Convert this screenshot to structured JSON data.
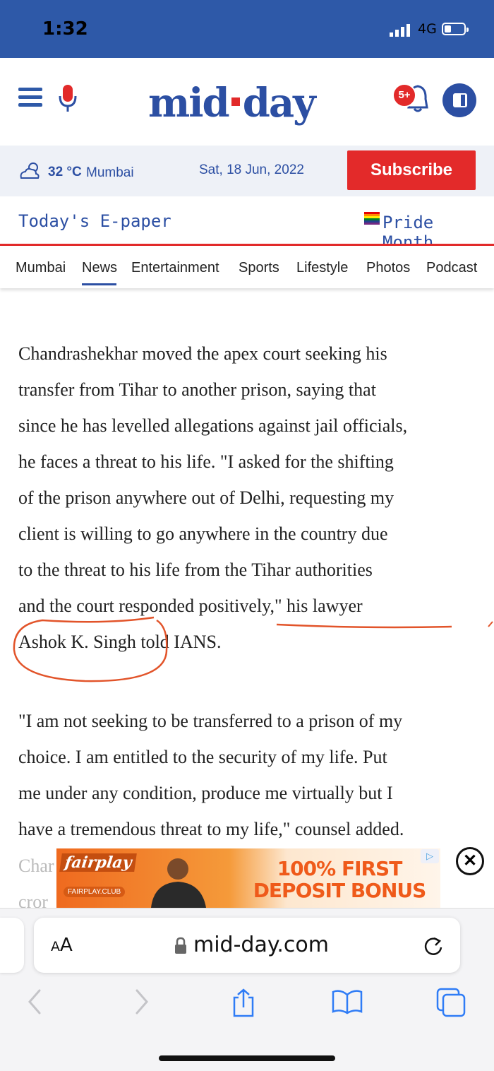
{
  "status_bar": {
    "time": "1:32",
    "network": "4G"
  },
  "header": {
    "logo_left": "mid",
    "logo_right": "day",
    "notification_count": "5+"
  },
  "info_bar": {
    "temperature": "32 °C",
    "city": "Mumbai",
    "date": "Sat, 18 Jun, 2022",
    "subscribe_label": "Subscribe"
  },
  "links": {
    "epaper": "Today's E-paper",
    "pride": "Pride Month"
  },
  "nav": {
    "items": [
      "Mumbai",
      "News",
      "Entertainment",
      "Sports",
      "Lifestyle",
      "Photos",
      "Podcast"
    ],
    "active": "News"
  },
  "article": {
    "lines1": [
      "Chandrashekhar moved the apex court seeking his",
      "transfer from Tihar to another prison, saying that",
      "since he has levelled allegations against jail officials,",
      "he faces a threat to his life. \"I asked for the shifting",
      "of the prison anywhere out of Delhi, requesting my",
      "client is willing to go anywhere in the country due",
      "to the threat to his life from the Tihar authorities",
      "and the court responded positively,\" his lawyer",
      "Ashok K. Singh told IANS."
    ],
    "lines2": [
      "\"I am not seeking to be transferred to a prison of my",
      "choice. I am entitled to the security of my life. Put",
      "me under any condition, produce me virtually but I",
      "have a tremendous threat to my life,\" counsel added."
    ],
    "lines3": [
      "Char",
      "cror"
    ]
  },
  "ad": {
    "brand": "fairplay",
    "brand_sub": "FAIRPLAY.CLUB",
    "line1": "100% FIRST",
    "line2": "DEPOSIT BONUS"
  },
  "browser": {
    "text_size_label_big": "A",
    "text_size_label_small": "A",
    "url": "mid-day.com"
  },
  "colors": {
    "brand_blue": "#2c4fa3",
    "status_blue": "#2e59a8",
    "accent_red": "#e32a2a",
    "annotation_red": "#e2542a"
  }
}
